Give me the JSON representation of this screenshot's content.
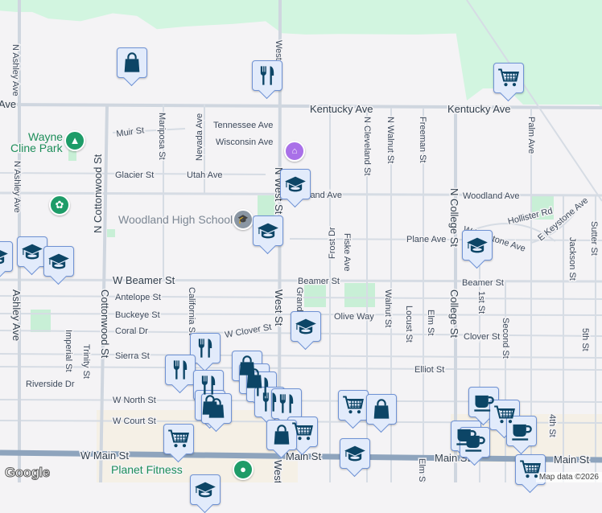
{
  "colors": {
    "park": "#d2f5e0",
    "background": "#f4f3f5",
    "road": "#d6dce4",
    "main_road": "#8ea4bd",
    "marker_fill": "#e2ebfb",
    "marker_border": "#6f92d4",
    "marker_icon": "#0c4566"
  },
  "streets": {
    "kentucky_ave": "Kentucky Ave",
    "ave_partial": "Ave",
    "n_ashley_ave": "N Ashley Ave",
    "ashley_ave": "Ashley Ave",
    "muir_st": "Muir St",
    "mariposa_st": "Mariposa St",
    "nevada_ave": "Nevada Ave",
    "tennessee_ave": "Tennessee Ave",
    "wisconsin_ave": "Wisconsin Ave",
    "glacier_st": "Glacier St",
    "utah_ave": "Utah Ave",
    "n_cottonwood_st": "N Cottonwood St",
    "cottonwood_st": "Cottonwood St",
    "west_st": "West St",
    "n_west_st": "N West St",
    "west_partial": "West",
    "woodland_ave": "Woodland Ave",
    "woodland_ave_partial": "land Ave",
    "n_cleveland_st": "N Cleveland St",
    "n_walnut_st": "N Walnut St",
    "freeman_st": "Freeman St",
    "n_college_st": "N College St",
    "college_st": "College St",
    "palm_ave": "Palm Ave",
    "hollister_rd": "Hollister Rd",
    "w_keystone_ave": "W Keystone Ave",
    "e_keystone_ave": "E Keystone Ave",
    "sutter_st": "Sutter St",
    "jackson_st": "Jackson St",
    "plane_ave": "Plane Ave",
    "frost_dr": "Frost Dr",
    "fiske_ave": "Fiske Ave",
    "w_beamer_st": "W Beamer St",
    "beamer_st": "Beamer St",
    "antelope_st": "Antelope St",
    "buckeye_st": "Buckeye St",
    "coral_dr": "Coral Dr",
    "w_clover_st": "W Clover St",
    "clover_st": "Clover St",
    "olive_way": "Olive Way",
    "walnut_st": "Walnut St",
    "locust_st": "Locust St",
    "elm_st": "Elm St",
    "second_st": "Second St",
    "fifth_st": "5th St",
    "fourth_st": "4th St",
    "first_st": "1st St",
    "california_st": "California St",
    "grand": "Grand",
    "sierra_st": "Sierra St",
    "elliot_st": "Elliot St",
    "riverside_dr": "Riverside Dr",
    "imperial_st": "Imperial St",
    "trinity_st": "Trinity St",
    "w_north_st": "W North St",
    "w_court_st": "W Court St",
    "w_main_st": "W Main St",
    "main_st": "Main St"
  },
  "places": {
    "wayne_cline_park": [
      "Wayne",
      "Cline Park"
    ],
    "woodland_high_school": "Woodland High School",
    "planet_fitness": "Planet Fitness"
  },
  "footer": {
    "logo": "Google",
    "attribution": "Map data ©2026"
  }
}
